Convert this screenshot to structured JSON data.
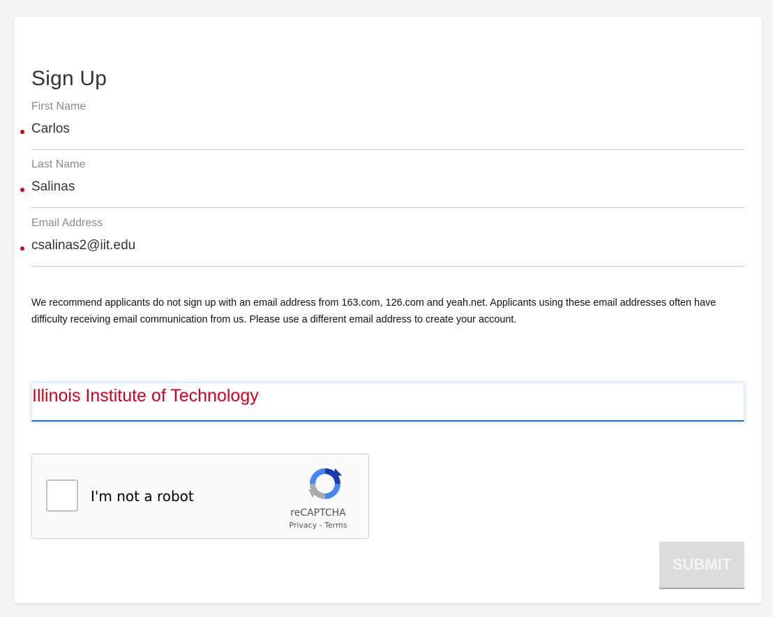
{
  "form": {
    "title": "Sign Up",
    "fields": [
      {
        "label": "First Name",
        "value": "Carlos",
        "required": true
      },
      {
        "label": "Last Name",
        "value": "Salinas",
        "required": true
      },
      {
        "label": "Email Address",
        "value": "csalinas2@iit.edu",
        "required": true
      }
    ],
    "notice": "We recommend applicants do not sign up with an email address from 163.com, 126.com and yeah.net. Applicants using these email addresses often have difficulty receiving email communication from us. Please use a different email address to create your account.",
    "school": {
      "value": "Illinois Institute of Technology"
    },
    "submit_label": "SUBMIT"
  },
  "captcha": {
    "label": "I'm not a robot",
    "brand": "reCAPTCHA",
    "privacy": "Privacy",
    "separator": " - ",
    "terms": "Terms",
    "icon": "recaptcha-logo-icon"
  },
  "colors": {
    "required_marker": "#d0021b",
    "school_text": "#d0021b",
    "focus_underline": "#1f6fc3",
    "submit_disabled_bg": "#dcdcdc"
  }
}
